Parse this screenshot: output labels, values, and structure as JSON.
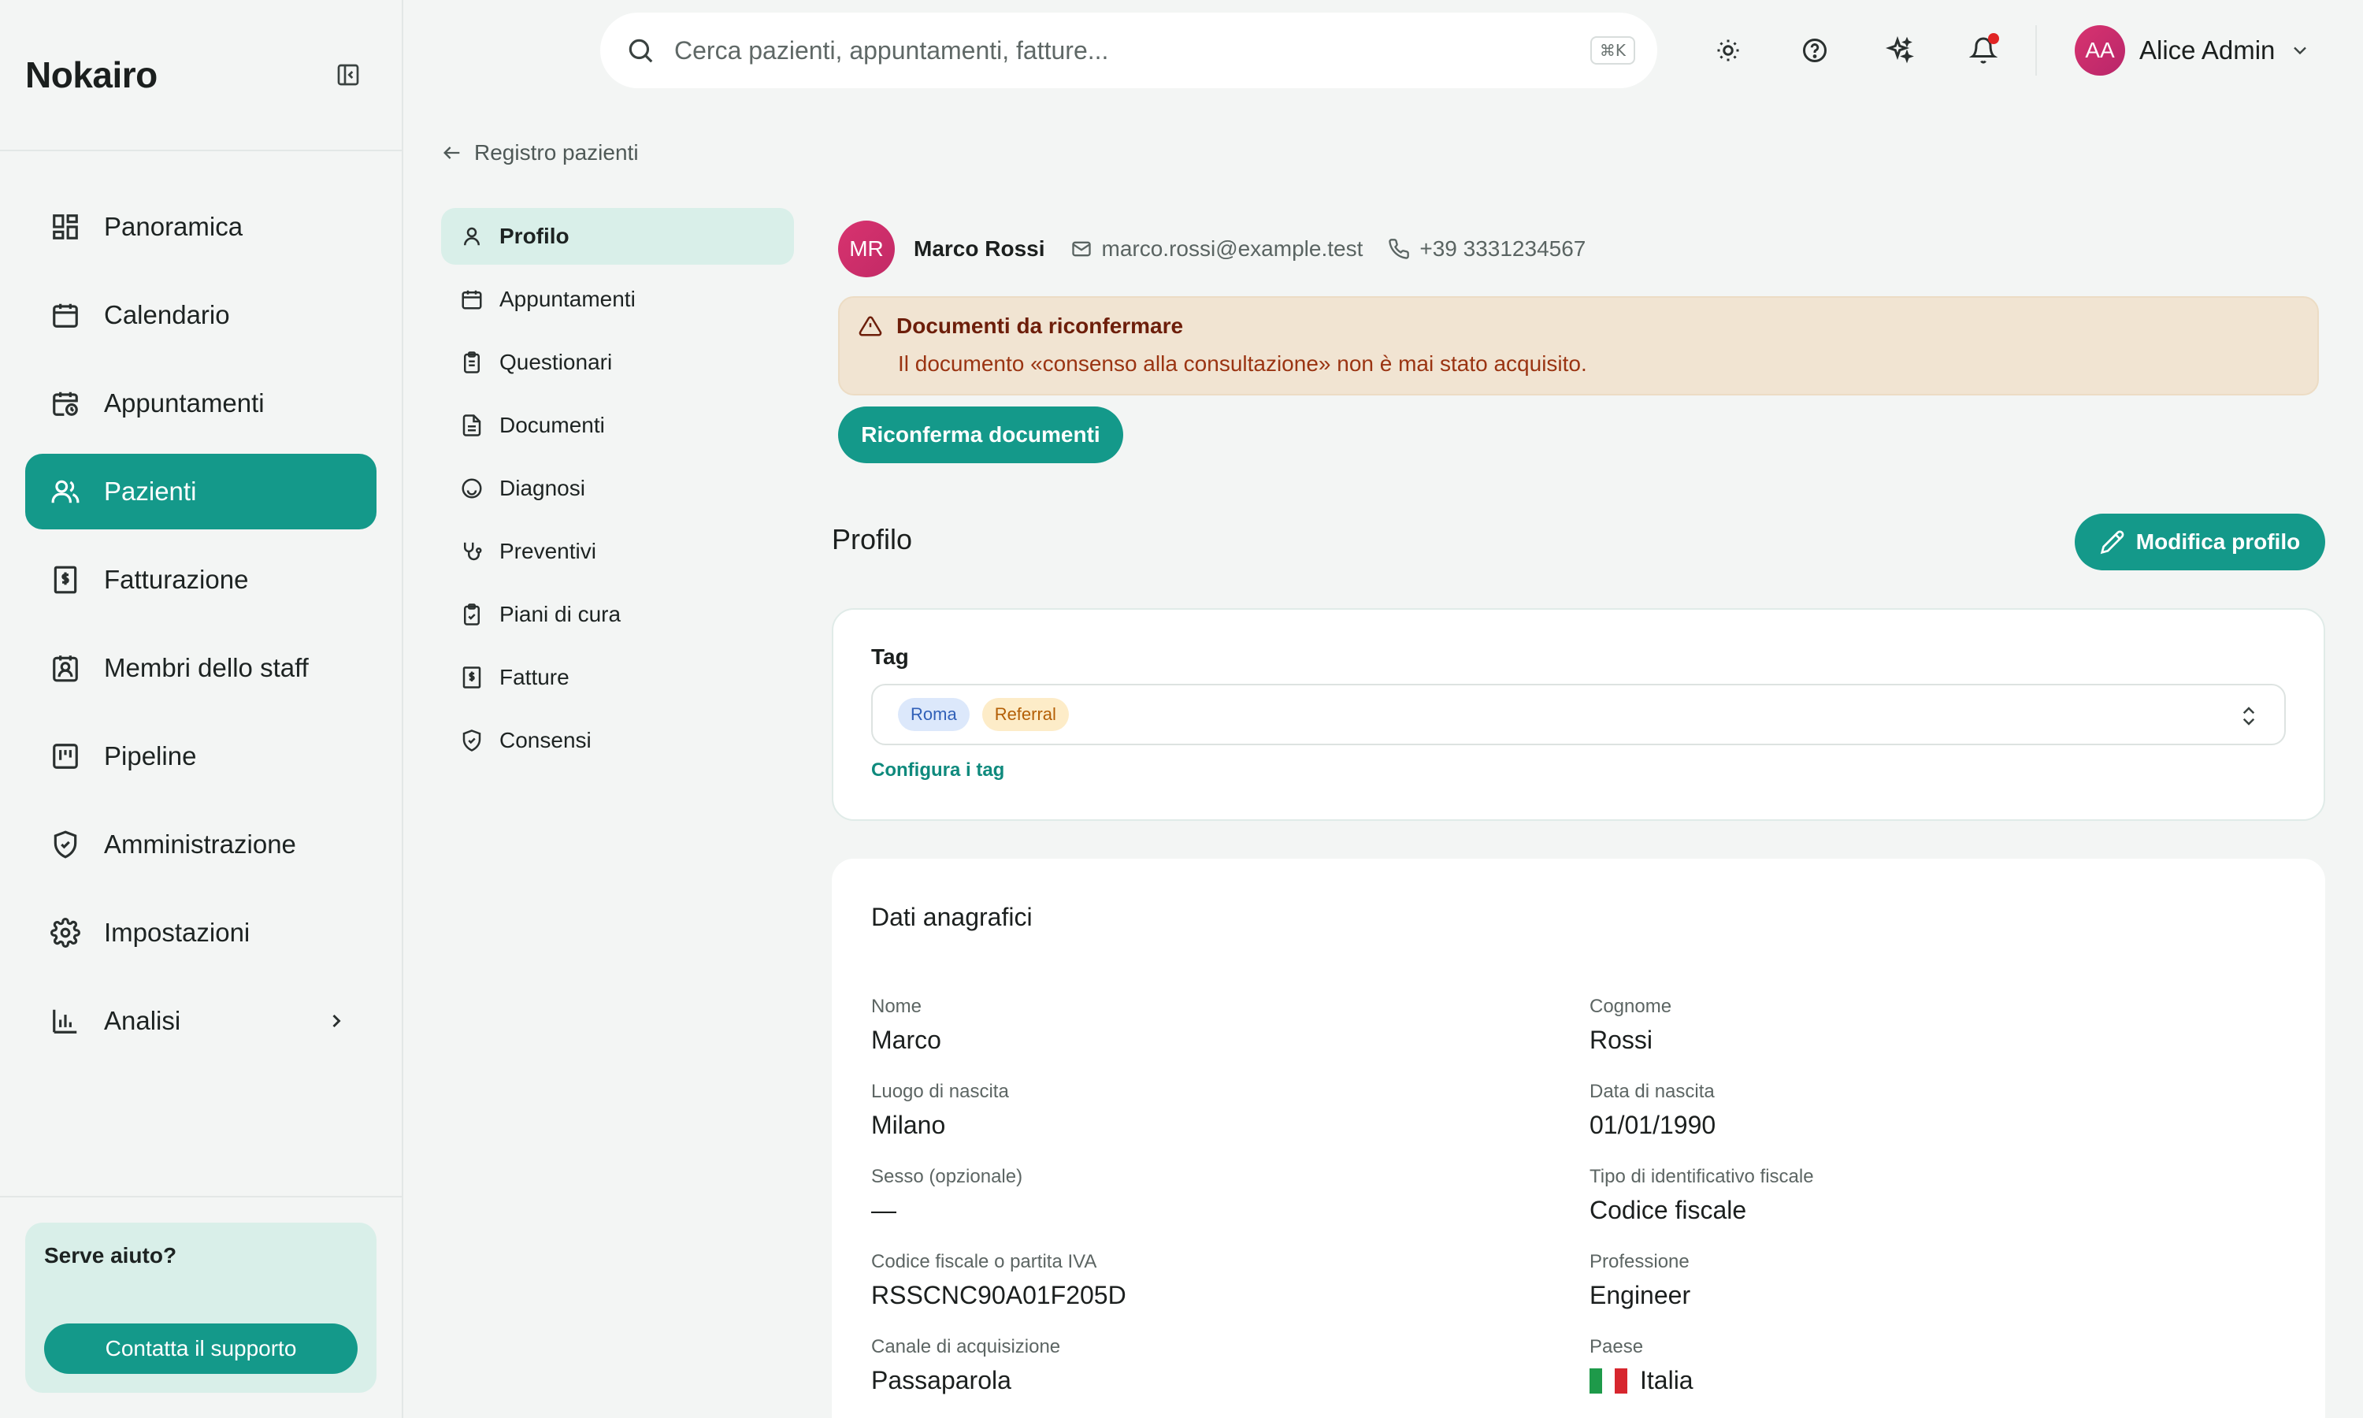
{
  "brand": "Nokairo",
  "sidebar": {
    "items": [
      {
        "label": "Panoramica",
        "icon": "dashboard-icon"
      },
      {
        "label": "Calendario",
        "icon": "calendar-icon"
      },
      {
        "label": "Appuntamenti",
        "icon": "calendar-clock-icon"
      },
      {
        "label": "Pazienti",
        "icon": "users-icon",
        "active": true
      },
      {
        "label": "Fatturazione",
        "icon": "invoice-icon"
      },
      {
        "label": "Membri dello staff",
        "icon": "staff-badge-icon"
      },
      {
        "label": "Pipeline",
        "icon": "kanban-icon"
      },
      {
        "label": "Amministrazione",
        "icon": "shield-check-icon"
      },
      {
        "label": "Impostazioni",
        "icon": "gear-icon"
      },
      {
        "label": "Analisi",
        "icon": "bar-chart-icon"
      }
    ],
    "help": {
      "title": "Serve aiuto?",
      "button": "Contatta il supporto"
    }
  },
  "topbar": {
    "search_placeholder": "Cerca pazienti, appuntamenti, fatture...",
    "shortcut": "⌘K",
    "icons": [
      "sun-icon",
      "help-circle-icon",
      "sparkles-icon",
      "bell-icon"
    ],
    "user": {
      "initials": "AA",
      "name": "Alice Admin"
    }
  },
  "back_link": "Registro pazienti",
  "subnav": [
    {
      "label": "Profilo",
      "icon": "user-icon",
      "active": true
    },
    {
      "label": "Appuntamenti",
      "icon": "calendar-icon"
    },
    {
      "label": "Questionari",
      "icon": "clipboard-list-icon"
    },
    {
      "label": "Documenti",
      "icon": "file-text-icon"
    },
    {
      "label": "Diagnosi",
      "icon": "smile-icon"
    },
    {
      "label": "Preventivi",
      "icon": "stethoscope-icon"
    },
    {
      "label": "Piani di cura",
      "icon": "clipboard-check-icon"
    },
    {
      "label": "Fatture",
      "icon": "invoice-icon"
    },
    {
      "label": "Consensi",
      "icon": "shield-check-icon"
    }
  ],
  "patient": {
    "initials": "MR",
    "name": "Marco Rossi",
    "email": "marco.rossi@example.test",
    "phone": "+39 3331234567"
  },
  "alert": {
    "title": "Documenti da riconfermare",
    "text": "Il documento «consenso alla consultazione» non è mai stato acquisito."
  },
  "reconfirm_button": "Riconferma documenti",
  "section_title": "Profilo",
  "edit_button": "Modifica profilo",
  "tags": {
    "label": "Tag",
    "chips": [
      {
        "label": "Roma",
        "color": "#dce8fb"
      },
      {
        "label": "Referral",
        "color": "#fdecc8"
      }
    ],
    "configure_link": "Configura i tag"
  },
  "personal": {
    "title": "Dati anagrafici",
    "fields": [
      {
        "label": "Nome",
        "value": "Marco"
      },
      {
        "label": "Cognome",
        "value": "Rossi"
      },
      {
        "label": "Luogo di nascita",
        "value": "Milano"
      },
      {
        "label": "Data di nascita",
        "value": "01/01/1990"
      },
      {
        "label": "Sesso (opzionale)",
        "value": "—"
      },
      {
        "label": "Tipo di identificativo fiscale",
        "value": "Codice fiscale"
      },
      {
        "label": "Codice fiscale o partita IVA",
        "value": "RSSCNC90A01F205D"
      },
      {
        "label": "Professione",
        "value": "Engineer"
      },
      {
        "label": "Canale di acquisizione",
        "value": "Passaparola"
      },
      {
        "label": "Paese",
        "value": "Italia",
        "flag": "italy-flag-icon"
      }
    ]
  },
  "colors": {
    "accent": "#14998a",
    "accent_soft": "#d9efe9",
    "alert_bg": "#f1e4d2",
    "alert_text": "#9a3412"
  }
}
